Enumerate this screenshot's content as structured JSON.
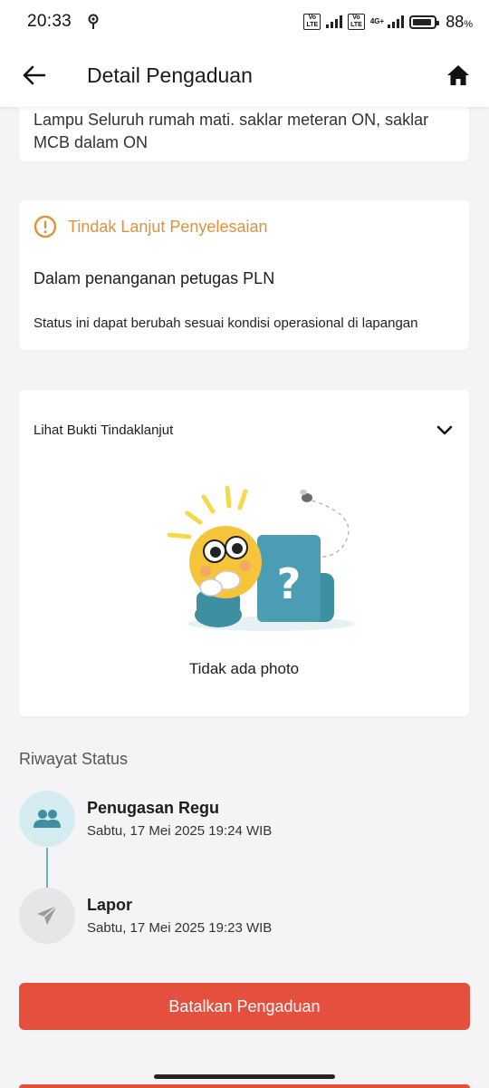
{
  "status_bar": {
    "time": "20:33",
    "volte_label": "Vo LTE",
    "network_label": "4G+",
    "battery_percent": "88",
    "battery_unit": "%"
  },
  "app_bar": {
    "title": "Detail Pengaduan",
    "back_icon": "arrow-left-icon",
    "home_icon": "home-icon"
  },
  "description": {
    "text": "Lampu Seluruh rumah mati. saklar meteran ON, saklar MCB dalam ON"
  },
  "follow_up": {
    "label": "Tindak Lanjut Penyelesaian",
    "status_text": "Dalam penanganan petugas PLN",
    "note": "Status ini dapat berubah sesuai kondisi operasional di lapangan",
    "accent_color": "#e0913a"
  },
  "evidence": {
    "label": "Lihat Bukti Tindaklanjut",
    "empty_text": "Tidak ada photo"
  },
  "history": {
    "title": "Riwayat Status",
    "items": [
      {
        "title": "Penugasan Regu",
        "time": "Sabtu, 17 Mei 2025 19:24 WIB",
        "icon": "users-icon",
        "active": true
      },
      {
        "title": "Lapor",
        "time": "Sabtu, 17 Mei 2025 19:23 WIB",
        "icon": "paper-plane-icon",
        "active": false
      }
    ]
  },
  "actions": {
    "cancel_label": "Batalkan Pengaduan",
    "cancel_color": "#e5503e"
  }
}
